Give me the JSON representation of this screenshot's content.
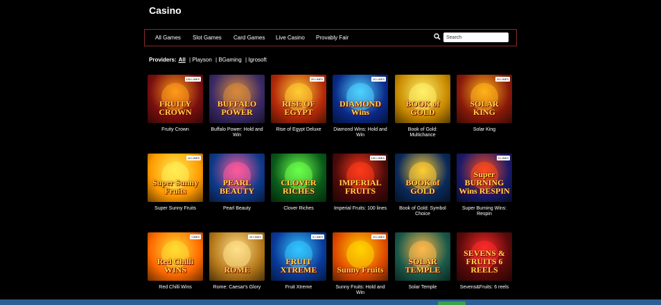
{
  "page_title": "Casino",
  "nav": {
    "items": [
      "All Games",
      "Slot Games",
      "Card Games",
      "Live Casino",
      "Provably Fair"
    ],
    "search_placeholder": "Search"
  },
  "providers": {
    "label": "Providers:",
    "all": "All",
    "list": [
      "| Playson",
      "| BGaming",
      "| Igrosoft"
    ]
  },
  "games": [
    {
      "title": "Fruity Crown",
      "art": "FRUITY CROWN",
      "badge": "100 LINES",
      "bg": "#7a0f0f",
      "glow": "#ff9a1a"
    },
    {
      "title": "Buffalo Power: Hold and Win",
      "art": "BUFFALO POWER",
      "badge": "",
      "bg": "#3b2a66",
      "glow": "#d98b3a"
    },
    {
      "title": "Rise of Egypt Deluxe",
      "art": "RISE OF EGYPT",
      "badge": "20 LINES",
      "bg": "#b52a0a",
      "glow": "#ffcc33"
    },
    {
      "title": "Diamond Wins: Hold and Win",
      "art": "DIAMOND Wins",
      "badge": "10 LINES",
      "bg": "#0b2a8a",
      "glow": "#4fd2ff"
    },
    {
      "title": "Book of Gold: Multichance",
      "art": "BOOK of GOLD",
      "badge": "",
      "bg": "#c98a00",
      "glow": "#fff06a"
    },
    {
      "title": "Solar King",
      "art": "SOLAR KING",
      "badge": "20 LINES",
      "bg": "#8a1a0a",
      "glow": "#ffb21a"
    },
    {
      "title": "Super Sunny Fruits",
      "art": "Super Sunny Fruits",
      "badge": "10 LINES",
      "bg": "#ff9a00",
      "glow": "#ffee55"
    },
    {
      "title": "Pearl Beauty",
      "art": "PEARL BEAUTY",
      "badge": "",
      "bg": "#0f3a8a",
      "glow": "#ff5a9a"
    },
    {
      "title": "Clover Riches",
      "art": "CLOVER RICHES",
      "badge": "",
      "bg": "#0a5a1a",
      "glow": "#6aff4a"
    },
    {
      "title": "Imperial Fruits: 100 lines",
      "art": "IMPERIAL FRUITS",
      "badge": "100 LINES",
      "bg": "#4a0a0a",
      "glow": "#ff3a1a"
    },
    {
      "title": "Book of Gold: Symbol Choice",
      "art": "BOOK of GOLD",
      "badge": "",
      "bg": "#0a2a5a",
      "glow": "#ffcc33"
    },
    {
      "title": "Super Burning Wins: Respin",
      "art": "Super BURNING Wins RESPIN",
      "badge": "5 LINES",
      "bg": "#1a1a6a",
      "glow": "#ff4a1a"
    },
    {
      "title": "Red Chilli Wins",
      "art": "Red Chilli WINS",
      "badge": "LINES",
      "bg": "#ff6a00",
      "glow": "#ffdd33"
    },
    {
      "title": "Rome: Caesar's Glory",
      "art": "ROME",
      "badge": "20 LINES",
      "bg": "#b5781a",
      "glow": "#ffe08a"
    },
    {
      "title": "Fruit Xtreme",
      "art": "FRUIT XTREME",
      "badge": "5 LINES",
      "bg": "#0a3a9a",
      "glow": "#33c4ff"
    },
    {
      "title": "Sunny Fruits: Hold and Win",
      "art": "Sunny Fruits",
      "badge": "10 LINES",
      "bg": "#e04a00",
      "glow": "#ffd400"
    },
    {
      "title": "Solar Temple",
      "art": "SOLAR TEMPLE",
      "badge": "",
      "bg": "#1a5a4a",
      "glow": "#ffb84a"
    },
    {
      "title": "Sevens&Fruits: 6 reels",
      "art": "SEVENS & FRUITS 6 REELS",
      "badge": "",
      "bg": "#5a0a0a",
      "glow": "#ff2a2a"
    }
  ],
  "colors": {
    "background": "#000000",
    "nav_border": "#8a2a2a",
    "bottom_bar": "#2d5f95"
  }
}
